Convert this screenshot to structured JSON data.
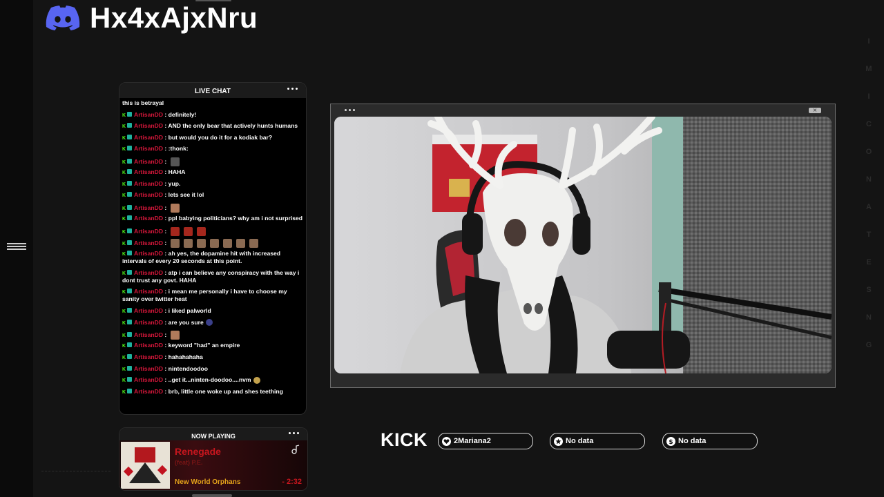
{
  "header": {
    "discord_logo": "discord-logo-icon",
    "server_code": "Hx4xAjxNru"
  },
  "right_edge_letters": [
    "I",
    "M",
    "I",
    "C",
    "O",
    "N",
    "A",
    "T",
    "E",
    "S",
    "N",
    "G"
  ],
  "chat": {
    "title": "LIVE CHAT",
    "menu_icon": "more-dots-icon",
    "username": "ArtisanDD",
    "messages": [
      {
        "plain": true,
        "text": "this is betrayal"
      },
      {
        "text": "definitely!"
      },
      {
        "text": "AND the only bear that actively hunts humans"
      },
      {
        "text": "but would you do it for a kodiak bar?"
      },
      {
        "text": ":thonk:"
      },
      {
        "emotes": [
          "e6"
        ],
        "text": ""
      },
      {
        "text": "HAHA"
      },
      {
        "text": "yup."
      },
      {
        "text": "lets see it lol"
      },
      {
        "emotes": [
          "e1"
        ],
        "text": ""
      },
      {
        "text": "ppl babying politicians? why am i not surprised"
      },
      {
        "emotes": [
          "e2",
          "e2",
          "e2"
        ],
        "text": ""
      },
      {
        "emotes": [
          "e3",
          "e3",
          "e3",
          "e3",
          "e3",
          "e3",
          "e3"
        ],
        "text": ""
      },
      {
        "text": "ah yes, the dopamine hit with increased intervals of every 20 seconds at this point."
      },
      {
        "text": "atp i can believe any conspiracy with the way i dont trust any govt. HAHA"
      },
      {
        "text": "i mean me personally i have to choose my sanity over twitter heat"
      },
      {
        "text": "i liked palworld"
      },
      {
        "text": "are you sure",
        "trail_emote": "e5"
      },
      {
        "emotes": [
          "e1"
        ],
        "text": ""
      },
      {
        "text": "keyword \"had\" an empire"
      },
      {
        "text": "hahahahaha"
      },
      {
        "text": "nintendoodoo"
      },
      {
        "text": "..get it...ninten-doodoo....nvm",
        "trail_emote": "e4"
      },
      {
        "text": "brb, little one woke up and shes teething"
      }
    ]
  },
  "now_playing": {
    "title": "NOW PLAYING",
    "menu_icon": "more-dots-icon",
    "track": "Renegade",
    "track_note": "(feat) P.E.",
    "artist": "New World Orphans",
    "remaining": "- 2:32",
    "service_icon": "music-note-icon"
  },
  "camera": {
    "dots_icon": "more-dots-icon",
    "close_icon": "close-icon",
    "close_glyph": "×"
  },
  "socials": {
    "platform": "KICK",
    "items": [
      {
        "icon": "heart-icon",
        "label": "2Mariana2"
      },
      {
        "icon": "star-icon",
        "label": "No data"
      },
      {
        "icon": "dollar-icon",
        "label": "No data"
      }
    ]
  }
}
